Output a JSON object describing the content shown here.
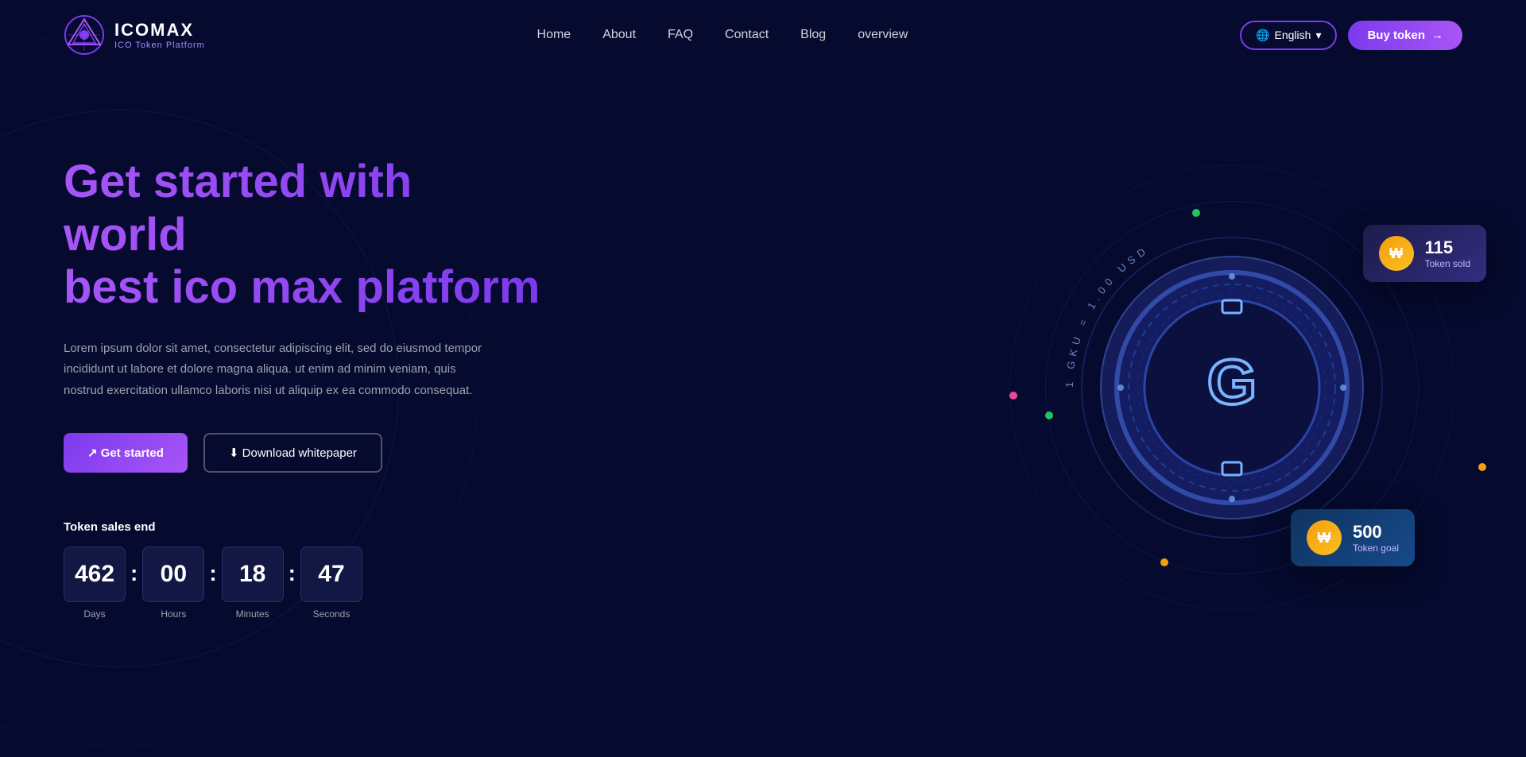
{
  "brand": {
    "name": "ICOMAX",
    "sub": "ICO Token Platform"
  },
  "nav": {
    "links": [
      {
        "label": "Home",
        "id": "home"
      },
      {
        "label": "About",
        "id": "about"
      },
      {
        "label": "FAQ",
        "id": "faq"
      },
      {
        "label": "Contact",
        "id": "contact"
      },
      {
        "label": "Blog",
        "id": "blog"
      },
      {
        "label": "overview",
        "id": "overview"
      }
    ],
    "language": "English",
    "buy_token": "Buy token"
  },
  "hero": {
    "title_line1": "Get started with world",
    "title_line2": "best ico max platform",
    "description": "Lorem ipsum dolor sit amet, consectetur adipiscing elit, sed do eiusmod tempor incididunt ut labore et dolore magna aliqua. ut enim ad minim veniam, quis nostrud exercitation ullamco laboris nisi ut aliquip ex ea commodo consequat.",
    "btn_get_started": "↗ Get started",
    "btn_download": "⬇ Download whitepaper"
  },
  "countdown": {
    "label": "Token sales end",
    "days": "462",
    "hours": "00",
    "minutes": "18",
    "seconds": "47",
    "unit_days": "Days",
    "unit_hours": "Hours",
    "unit_minutes": "Minutes",
    "unit_seconds": "Seconds"
  },
  "token_sold_card": {
    "number": "115",
    "label": "Token sold"
  },
  "token_goal_card": {
    "number": "500",
    "label": "Token goal"
  },
  "coin": {
    "exchange_label": "1 GKU = 1.00 USD"
  },
  "dots": [
    {
      "color": "#22c55e",
      "top": "155",
      "left": "390"
    },
    {
      "color": "#f59e0b",
      "top": "428",
      "left": "855"
    },
    {
      "color": "#a855f7",
      "top": "590",
      "left": "260"
    },
    {
      "color": "#ec4899",
      "top": "350",
      "left": "198"
    },
    {
      "color": "#22c55e",
      "top": "340",
      "left": "248"
    },
    {
      "color": "#f59e0b",
      "top": "755",
      "left": "470"
    }
  ]
}
